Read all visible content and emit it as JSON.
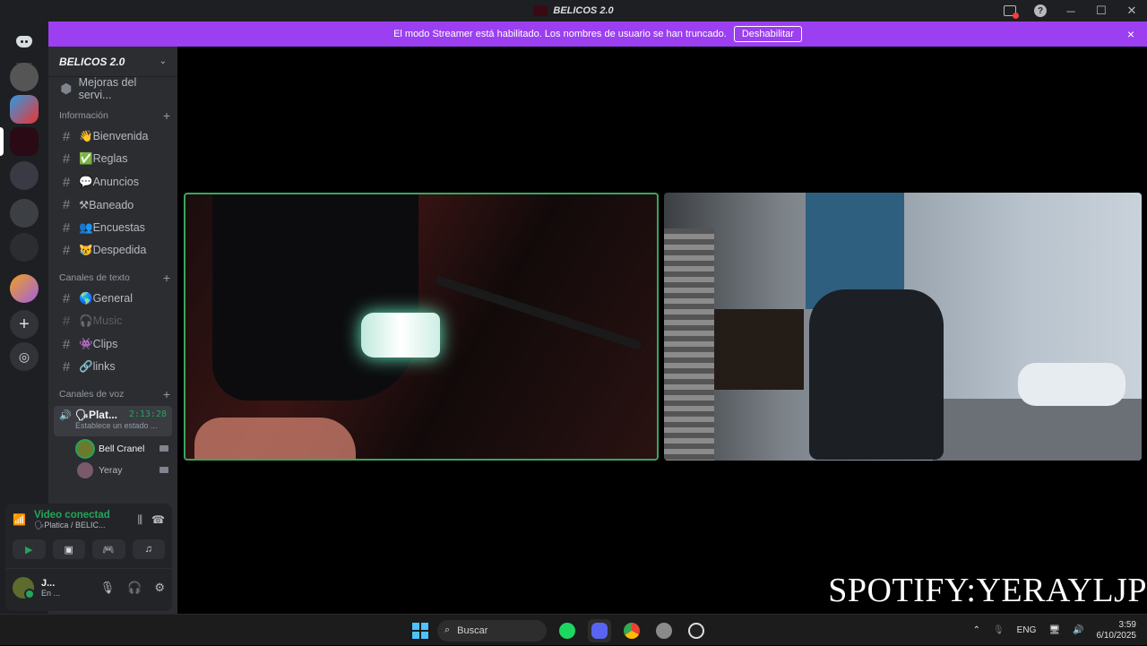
{
  "window": {
    "title": "BELICOS 2.0",
    "controls": [
      "minimize-icon",
      "maximize-icon",
      "close-icon"
    ]
  },
  "banner": {
    "message": "El modo Streamer está habilitado. Los nombres de usuario se han truncado.",
    "button": "Deshabilitar",
    "close": "×",
    "color": "#9b3ff0"
  },
  "sidebar": {
    "guild_name": "BELICOS 2.0",
    "top_item": "Mejoras del servi...",
    "categories": [
      {
        "label": "Información",
        "channels": [
          {
            "label": "👋Bienvenida"
          },
          {
            "label": "✅Reglas"
          },
          {
            "label": "💬Anuncios"
          },
          {
            "label": "⚒Baneado"
          },
          {
            "label": "👥Encuestas"
          },
          {
            "label": "😿Despedida"
          }
        ]
      },
      {
        "label": "Canales de texto",
        "channels": [
          {
            "label": "🌎General"
          },
          {
            "label": "🎧Music"
          },
          {
            "label": "👾Clips"
          },
          {
            "label": "🔗links"
          }
        ]
      },
      {
        "label": "Canales de voz"
      }
    ],
    "voice_channel": {
      "name": "🗣Plat...",
      "timer": "2:13:28",
      "status": "Establece un estado ..."
    },
    "voice_users": [
      {
        "name": "Bell Cranel"
      },
      {
        "name": "Yeray"
      }
    ]
  },
  "voice_panel": {
    "status": "Video conectad",
    "location": "🗣Platica / BELIC..."
  },
  "user": {
    "name": "J...",
    "status": "En ..."
  },
  "stage": {
    "overlay": "SPOTIFY:YERAYLJP"
  },
  "taskbar": {
    "search": "Buscar",
    "lang": "ENG",
    "time": "3:59",
    "date": "6/10/2025",
    "accent": "#4cc2ff"
  }
}
